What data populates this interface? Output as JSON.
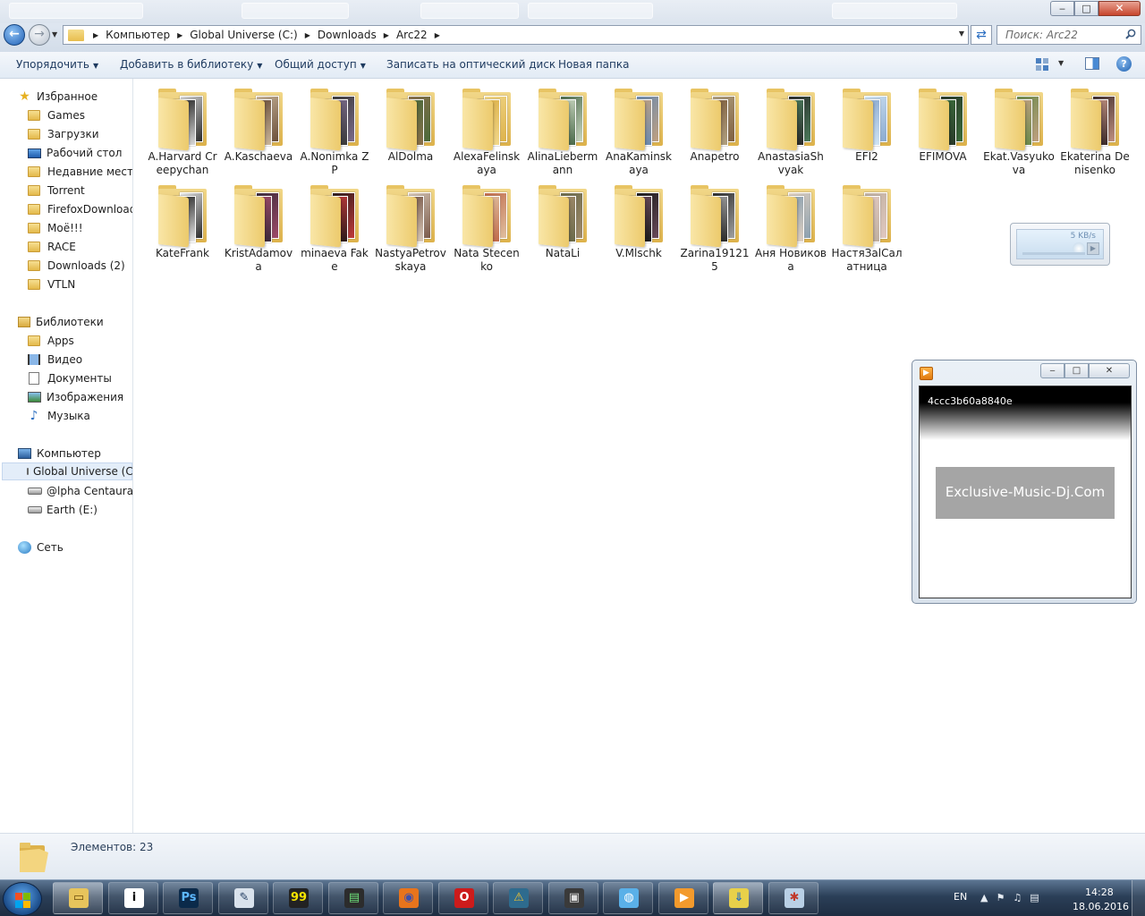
{
  "window": {
    "controls": {
      "minimize": "‒",
      "maximize": "□",
      "close": "✕"
    }
  },
  "navigation": {
    "breadcrumb": [
      "Компьютер",
      "Global Universe (C:)",
      "Downloads",
      "Arc22"
    ],
    "search_placeholder": "Поиск: Arc22"
  },
  "toolbar": {
    "organize": "Упорядочить",
    "add_to_library": "Добавить в библиотеку",
    "share": "Общий доступ",
    "burn": "Записать на оптический диск",
    "new_folder": "Новая папка",
    "help": "?"
  },
  "sidebar": {
    "favorites_header": "Избранное",
    "favorites": [
      "Games",
      "Загрузки",
      "Рабочий стол",
      "Недавние места",
      "Torrent",
      "FirefoxDownload",
      "Моё!!!",
      "RACE",
      "Downloads (2)",
      "VTLN"
    ],
    "libraries_header": "Библиотеки",
    "libraries": [
      "Apps",
      "Видео",
      "Документы",
      "Изображения",
      "Музыка"
    ],
    "computer_header": "Компьютер",
    "drives": [
      "Global Universe (C:)",
      "@lpha Centaura (D:)",
      "Earth (E:)"
    ],
    "network_header": "Сеть"
  },
  "folders": [
    {
      "label": "A.Harvard Creepychan"
    },
    {
      "label": "A.Kaschaeva"
    },
    {
      "label": "A.Nonimka ZP"
    },
    {
      "label": "AlDolma"
    },
    {
      "label": "AlexaFelinskaya"
    },
    {
      "label": "AlinaLiebermann"
    },
    {
      "label": "AnaKaminskaya"
    },
    {
      "label": "Anapetro"
    },
    {
      "label": "AnastasiaShvyak"
    },
    {
      "label": "EFI2"
    },
    {
      "label": "EFIMOVA"
    },
    {
      "label": "Ekat.Vasyukova"
    },
    {
      "label": "Ekaterina Denisenko"
    },
    {
      "label": "KateFrank"
    },
    {
      "label": "KristAdamova"
    },
    {
      "label": "minaeva Fake"
    },
    {
      "label": "NastyaPetrovskaya"
    },
    {
      "label": "Nata Stecenko"
    },
    {
      "label": "NataLi"
    },
    {
      "label": "V.Mlschk"
    },
    {
      "label": "Zarina191215"
    },
    {
      "label": "Аня Новикова"
    },
    {
      "label": "НастяЗаlСалатница"
    }
  ],
  "download_widget": {
    "speed": "5 KB/s"
  },
  "player": {
    "title": "4ccc3b60a8840e",
    "banner": "Exclusive-Music-Dj.Com"
  },
  "status": {
    "items_count": "Элементов: 23"
  },
  "taskbar": {
    "language": "EN",
    "time": "14:28",
    "date": "18.06.2016",
    "apps": [
      {
        "name": "explorer-app",
        "glyph": "▭",
        "bg": "#e7c45c",
        "fg": "#6a4a0a"
      },
      {
        "name": "info-app",
        "glyph": "i",
        "bg": "#ffffff",
        "fg": "#000000"
      },
      {
        "name": "photoshop-app",
        "glyph": "Ps",
        "bg": "#0b2a4a",
        "fg": "#5db8ff"
      },
      {
        "name": "editor-app",
        "glyph": "✎",
        "bg": "#d9e2ec",
        "fg": "#1e3a5f"
      },
      {
        "name": "monitor-app",
        "glyph": "99",
        "bg": "#222222",
        "fg": "#f5e400"
      },
      {
        "name": "terminal-app",
        "glyph": "▤",
        "bg": "#2c2c2c",
        "fg": "#6ee07a"
      },
      {
        "name": "firefox-app",
        "glyph": "◉",
        "bg": "#e8741c",
        "fg": "#3a4fb0"
      },
      {
        "name": "opera-app",
        "glyph": "O",
        "bg": "#cc1b1b",
        "fg": "#ffffff"
      },
      {
        "name": "warning-app",
        "glyph": "⚠",
        "bg": "#2e6b8e",
        "fg": "#f0c030"
      },
      {
        "name": "media-app",
        "glyph": "▣",
        "bg": "#3a3a3a",
        "fg": "#dddddd"
      },
      {
        "name": "network-app",
        "glyph": "◍",
        "bg": "#5ab0e8",
        "fg": "#ffffff"
      },
      {
        "name": "player-app",
        "glyph": "▶",
        "bg": "#f39a2c",
        "fg": "#ffffff"
      },
      {
        "name": "downloader-app",
        "glyph": "⇓",
        "bg": "#e8d04a",
        "fg": "#2a6ec2"
      },
      {
        "name": "paint-app",
        "glyph": "✱",
        "bg": "#b9d0e6",
        "fg": "#c0392b"
      }
    ]
  },
  "colors": {
    "accent": "#1f5fb5",
    "folder": "#e7c45c",
    "selection": "#e3edf9"
  }
}
